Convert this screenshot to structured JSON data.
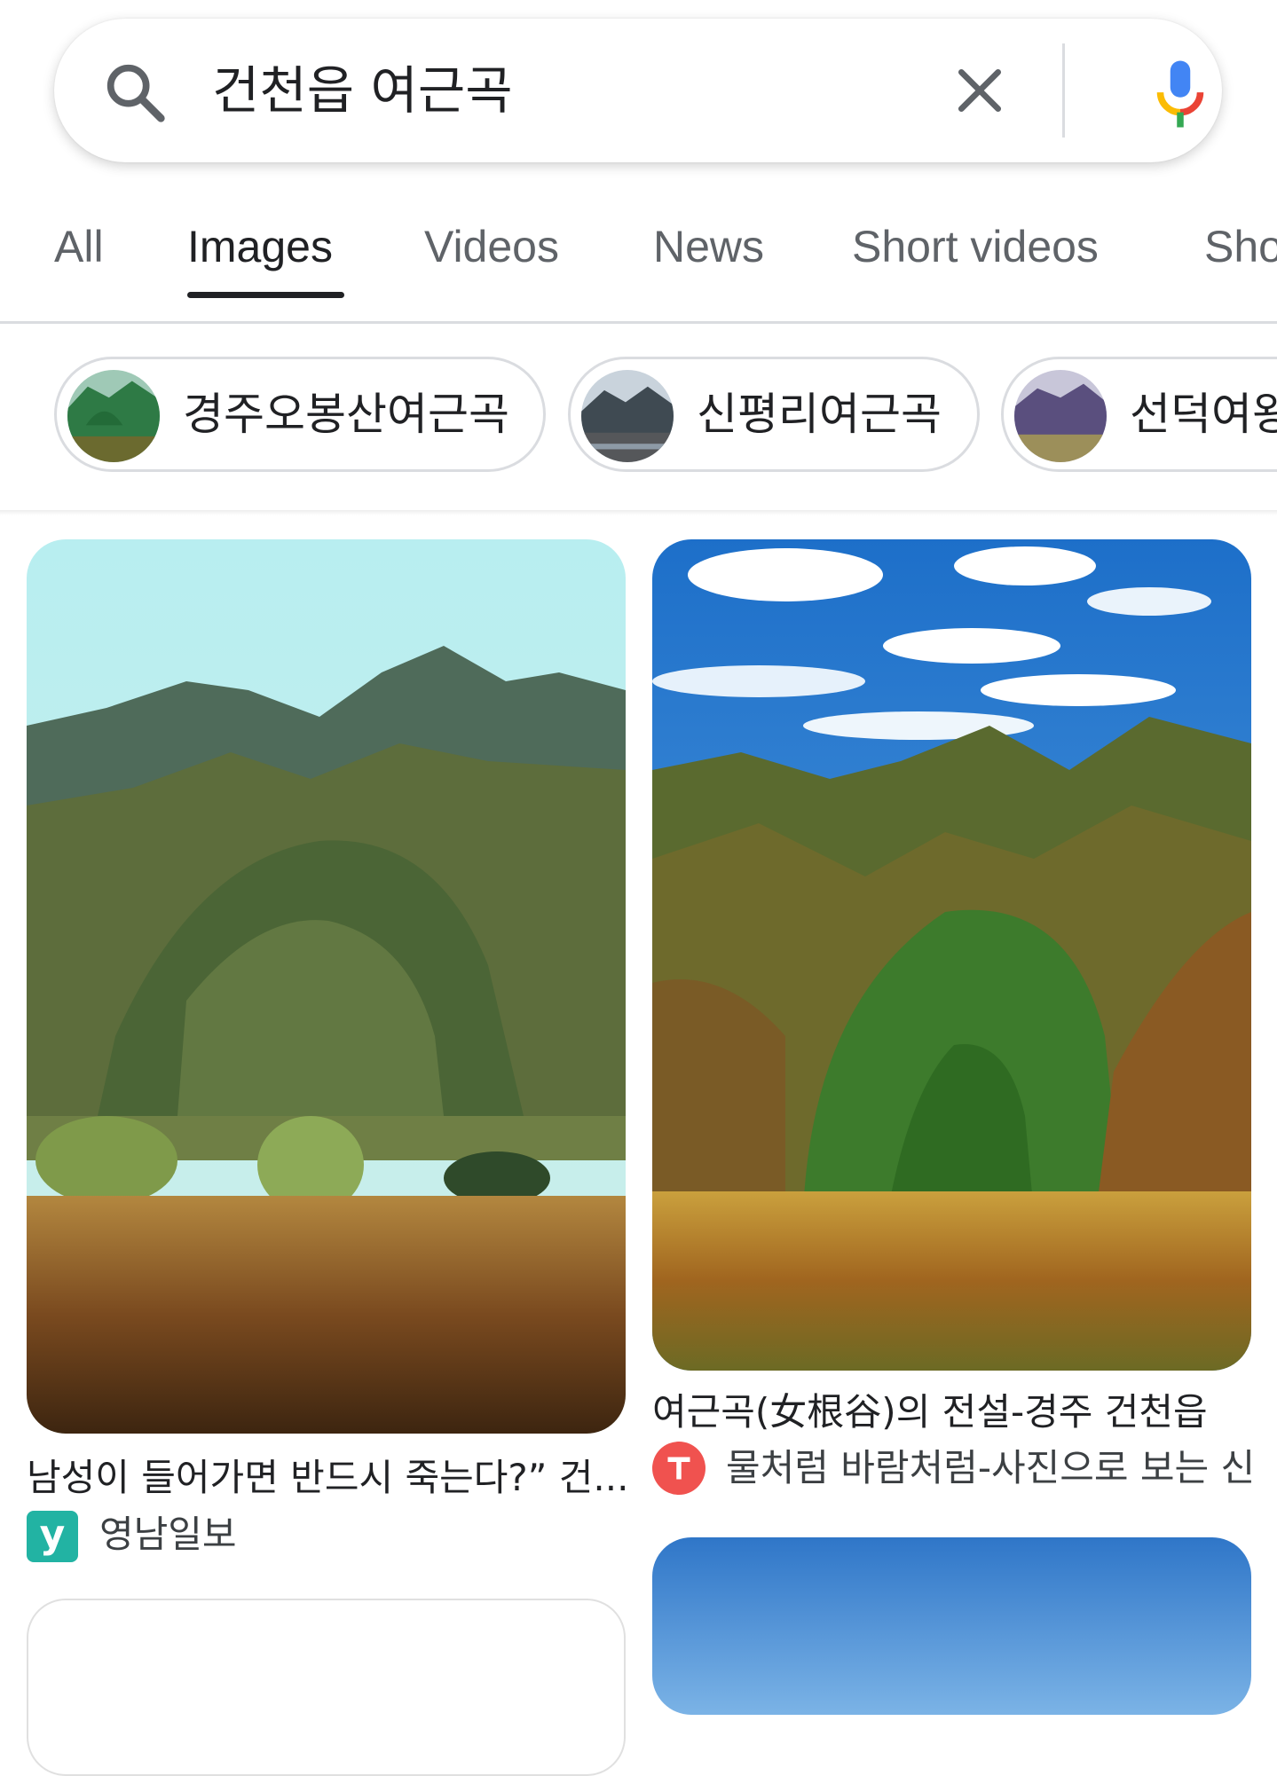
{
  "search": {
    "query": "건천읍 여근곡"
  },
  "tabs": [
    {
      "label": "All"
    },
    {
      "label": "Images",
      "active": true
    },
    {
      "label": "Videos"
    },
    {
      "label": "News"
    },
    {
      "label": "Short videos"
    },
    {
      "label": "Sho"
    }
  ],
  "chips": [
    {
      "label": "경주오봉산여근곡"
    },
    {
      "label": "신평리여근곡"
    },
    {
      "label": "선덕여왕"
    }
  ],
  "results": [
    {
      "title": "남성이 들어가면 반드시 죽는다?” 건...",
      "source": "영남일보",
      "favicon_letter": "y",
      "favicon_color": "#22b3a3"
    },
    {
      "title": "여근곡(女根谷)의 전설-경주 건천읍",
      "source": "물처럼 바람처럼-사진으로 보는 신",
      "favicon_color": "#f0524f"
    }
  ],
  "icons": {
    "search": "search-icon",
    "clear": "close-icon",
    "mic": "microphone-icon"
  },
  "colors": {
    "mic_blue": "#4285f4",
    "mic_red": "#ea4335",
    "mic_yellow": "#fbbc04",
    "mic_green": "#34a853"
  }
}
